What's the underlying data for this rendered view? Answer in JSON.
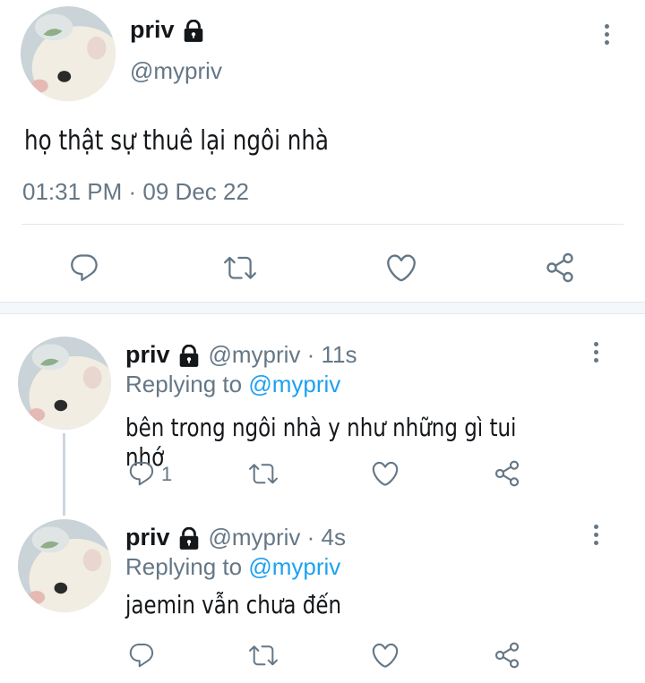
{
  "main_tweet": {
    "name": "priv",
    "handle": "@mypriv",
    "text": "họ thật sự thuê lại ngôi nhà",
    "timestamp": "01:31 PM · 09 Dec 22"
  },
  "replies": [
    {
      "name": "priv",
      "handle": "@mypriv · 11s",
      "replying_label": "Replying to",
      "replying_to": "@mypriv",
      "text": "bên trong ngôi nhà y như những gì tui nhớ",
      "reply_count": "1"
    },
    {
      "name": "priv",
      "handle": "@mypriv · 4s",
      "replying_label": "Replying to",
      "replying_to": "@mypriv",
      "text": "jaemin vẫn chưa đến",
      "reply_count": ""
    }
  ],
  "icons": {
    "reply": "reply-icon",
    "retweet": "retweet-icon",
    "like": "heart-icon",
    "share": "share-icon",
    "lock": "lock-icon",
    "more": "more-vertical-icon"
  },
  "colors": {
    "text": "#14171a",
    "secondary": "#657786",
    "accent": "#1da1f2",
    "divider": "#e1e8ed"
  }
}
